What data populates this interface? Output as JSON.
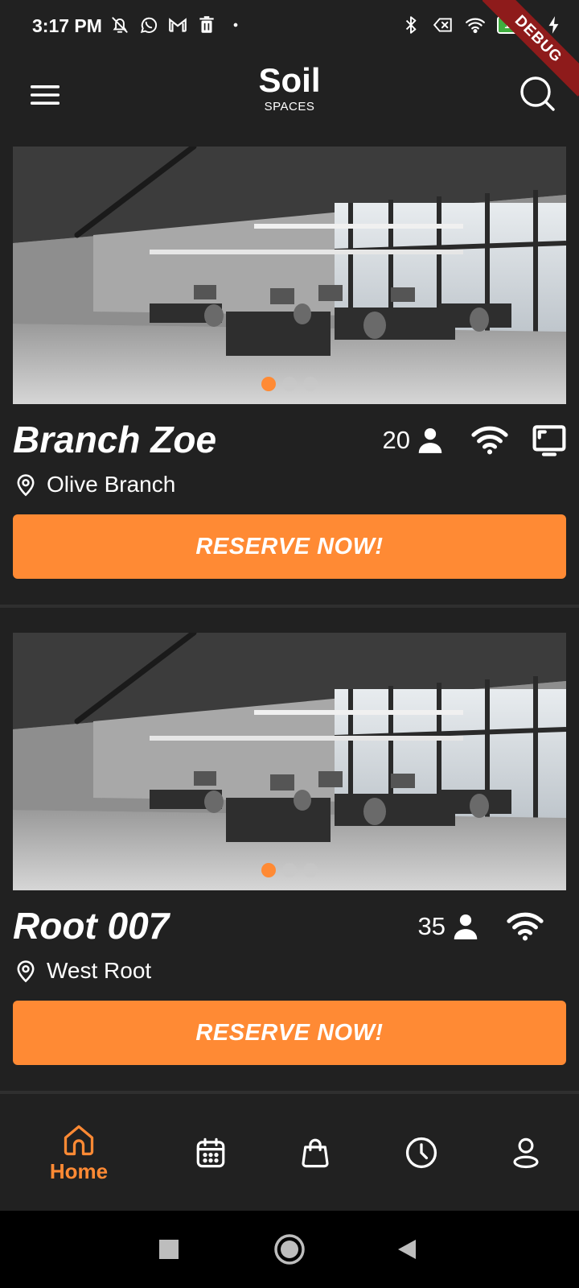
{
  "status_bar": {
    "time": "3:17 PM",
    "battery_level": "100",
    "left_icons": [
      "notifications-off-icon",
      "whatsapp-icon",
      "gmail-icon",
      "trash-icon",
      "dot-icon"
    ],
    "right_icons": [
      "bluetooth-icon",
      "no-sim-icon",
      "wifi-icon",
      "battery-icon",
      "charging-icon"
    ]
  },
  "debug_banner": "DEBUG",
  "app_bar": {
    "title": "Soil",
    "subtitle": "SPACES",
    "menu_icon": "menu-icon",
    "search_icon": "search-icon"
  },
  "spaces": [
    {
      "name": "Branch Zoe",
      "capacity": "20",
      "location": "Olive Branch",
      "amenities": [
        "people-icon",
        "wifi-icon",
        "monitor-icon"
      ],
      "reserve_label": "RESERVE NOW!",
      "carousel_dots": 3,
      "active_dot": 0
    },
    {
      "name": "Root 007",
      "capacity": "35",
      "location": "West Root",
      "amenities": [
        "people-icon",
        "wifi-icon"
      ],
      "reserve_label": "RESERVE NOW!",
      "carousel_dots": 3,
      "active_dot": 0
    }
  ],
  "bottom_nav": {
    "items": [
      {
        "icon": "home-icon",
        "label": "Home",
        "active": true
      },
      {
        "icon": "calendar-icon",
        "label": "",
        "active": false
      },
      {
        "icon": "shopping-bag-icon",
        "label": "",
        "active": false
      },
      {
        "icon": "clock-icon",
        "label": "",
        "active": false
      },
      {
        "icon": "profile-icon",
        "label": "",
        "active": false
      }
    ]
  },
  "colors": {
    "background": "#212121",
    "accent": "#ff8a34",
    "divider": "#2f2f2f",
    "debug_ribbon": "#8e1b1b"
  }
}
